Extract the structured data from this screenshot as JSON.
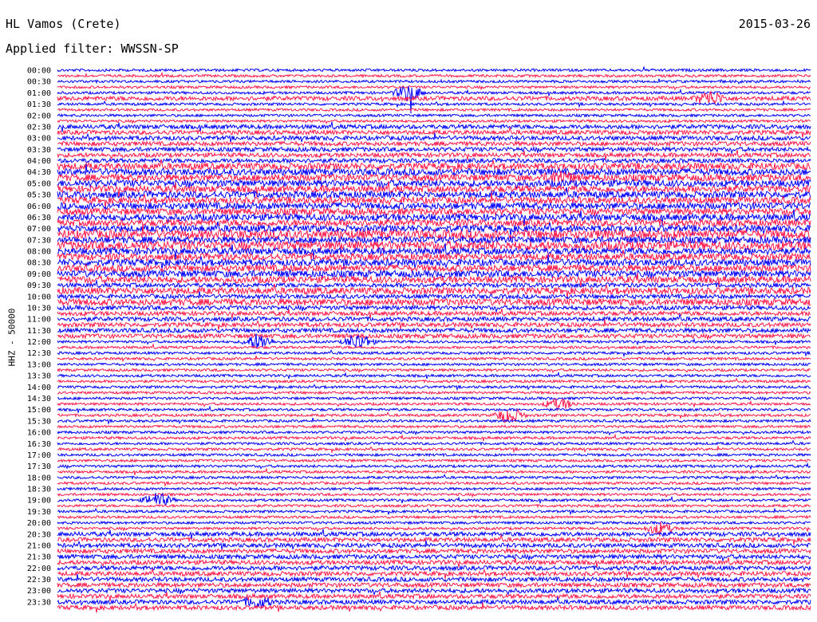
{
  "header": {
    "station": "HL Vamos (Crete)",
    "date": "2015-03-26",
    "filter": "Applied filter: WWSSN-SP"
  },
  "chart_data": {
    "type": "line",
    "title": "HL Vamos (Crete)",
    "ylabel": "HHZ - 50000",
    "filter": "WWSSN-SP",
    "date": "2015-03-26",
    "row_interval_minutes": 15,
    "row_labels": [
      "00:00",
      "00:30",
      "01:00",
      "01:30",
      "02:00",
      "02:30",
      "03:00",
      "03:30",
      "04:00",
      "04:30",
      "05:00",
      "05:30",
      "06:00",
      "06:30",
      "07:00",
      "07:30",
      "08:00",
      "08:30",
      "09:00",
      "09:30",
      "10:00",
      "10:30",
      "11:00",
      "11:30",
      "12:00",
      "12:30",
      "13:00",
      "13:30",
      "14:00",
      "14:30",
      "15:00",
      "15:30",
      "16:00",
      "16:30",
      "17:00",
      "17:30",
      "18:00",
      "18:30",
      "19:00",
      "19:30",
      "20:00",
      "20:30",
      "21:00",
      "21:30",
      "22:00",
      "22:30",
      "23:00",
      "23:30"
    ],
    "label_every_n_rows": 2,
    "series_colors": [
      "#0000ff",
      "#ff1a4d"
    ],
    "amplitude_levels": [
      1,
      1,
      1,
      1,
      1,
      2,
      1,
      1,
      1,
      1,
      2,
      2,
      2,
      2,
      2,
      2,
      2,
      3,
      3,
      3,
      3,
      3,
      3,
      3,
      3,
      3,
      3,
      3,
      3,
      4,
      3,
      4,
      3,
      3,
      3,
      3,
      3,
      3,
      2,
      3,
      2,
      3,
      2,
      2,
      2,
      2,
      2,
      2,
      1,
      1,
      1,
      1,
      1,
      1,
      1,
      1,
      1,
      1,
      1,
      1,
      1,
      1,
      1,
      1,
      1,
      1,
      1,
      1,
      1,
      1,
      1,
      1,
      1,
      1,
      1,
      1,
      1,
      1,
      1,
      1,
      1,
      1,
      2,
      2,
      2,
      2,
      2,
      2,
      2,
      2,
      2,
      2,
      2,
      2,
      2,
      2
    ],
    "events": [
      {
        "time": "01:00",
        "minute": 7,
        "strength": 3
      },
      {
        "time": "01:00",
        "minute": 13,
        "strength": 2.5
      },
      {
        "time": "04:30",
        "minute": 10,
        "strength": 2
      },
      {
        "time": "12:00",
        "minute": 4,
        "strength": 3
      },
      {
        "time": "12:00",
        "minute": 6,
        "strength": 3
      },
      {
        "time": "14:00",
        "minute": 40,
        "strength": 2
      },
      {
        "time": "15:00",
        "minute": 9,
        "strength": 3
      },
      {
        "time": "19:00",
        "minute": 2,
        "strength": 2.5
      },
      {
        "time": "19:30",
        "minute": 42,
        "strength": 2
      },
      {
        "time": "23:30",
        "minute": 4,
        "strength": 2
      }
    ]
  }
}
